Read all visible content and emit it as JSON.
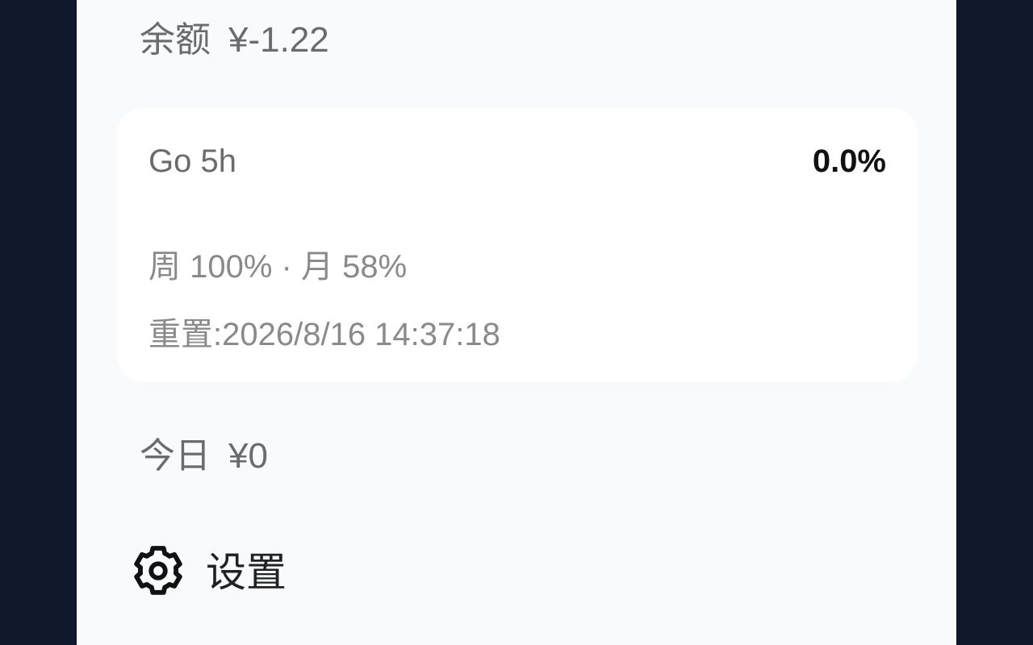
{
  "balance": {
    "label": "余额",
    "value": "¥-1.22"
  },
  "usage_card": {
    "title": "Go 5h",
    "percent": "0.0%",
    "detail": "周 100% · 月 58%",
    "reset": "重置:2026/8/16 14:37:18"
  },
  "today": {
    "label": "今日",
    "value": "¥0"
  },
  "settings": {
    "label": "设置",
    "icon": "gear-icon"
  }
}
